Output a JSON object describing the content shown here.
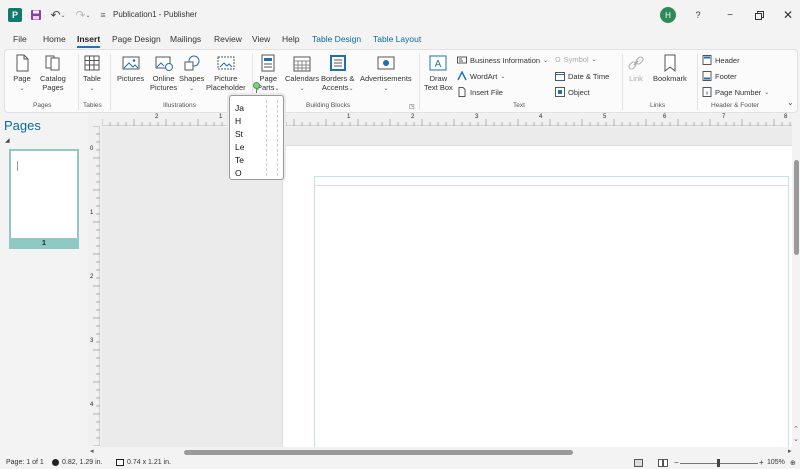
{
  "window": {
    "title": "Publication1  -  Publisher",
    "user_initial": "H",
    "help": "?",
    "minimize": "−",
    "close": "✕",
    "app_logo": "P"
  },
  "tabs": [
    {
      "label": "File"
    },
    {
      "label": "Home"
    },
    {
      "label": "Insert",
      "active": true
    },
    {
      "label": "Page Design"
    },
    {
      "label": "Mailings"
    },
    {
      "label": "Review"
    },
    {
      "label": "View"
    },
    {
      "label": "Help"
    },
    {
      "label": "Table Design",
      "contextual": true
    },
    {
      "label": "Table Layout",
      "contextual": true
    }
  ],
  "ribbon": {
    "page": "Page",
    "catalog_pages_1": "Catalog",
    "catalog_pages_2": "Pages",
    "table": "Table",
    "pictures": "Pictures",
    "online_pictures_1": "Online",
    "online_pictures_2": "Pictures",
    "shapes": "Shapes",
    "picture_placeholder_1": "Picture",
    "picture_placeholder_2": "Placeholder",
    "page_parts_1": "Page",
    "page_parts_2": "Parts",
    "calendars": "Calendars",
    "borders_accents_1": "Borders &",
    "borders_accents_2": "Accents",
    "advertisements": "Advertisements",
    "draw_text_box_1": "Draw",
    "draw_text_box_2": "Text Box",
    "business_information": "Business Information",
    "wordart": "WordArt",
    "insert_file": "Insert File",
    "symbol": "Symbol",
    "date_time": "Date & Time",
    "object": "Object",
    "link": "Link",
    "bookmark": "Bookmark",
    "header": "Header",
    "footer": "Footer",
    "page_number": "Page Number",
    "groups": {
      "pages": "Pages",
      "tables": "Tables",
      "illustrations": "Illustrations",
      "building_blocks": "Building Blocks",
      "text": "Text",
      "links": "Links",
      "header_footer": "Header & Footer"
    }
  },
  "pages_pane": {
    "title": "Pages",
    "thumb_number": "1"
  },
  "ruler_h_labels": [
    "2",
    "1",
    "0",
    "1",
    "2",
    "3",
    "4",
    "5",
    "6",
    "7",
    "8"
  ],
  "ruler_v_labels": [
    "0",
    "1",
    "2",
    "3",
    "4"
  ],
  "textbox_lines": [
    "Ja",
    "H",
    "St",
    "Le",
    "Te",
    "O"
  ],
  "status": {
    "page": "Page: 1 of 1",
    "position": "0.82, 1.29 in.",
    "size": "0.74 x 1.21 in.",
    "zoom": "105%"
  }
}
